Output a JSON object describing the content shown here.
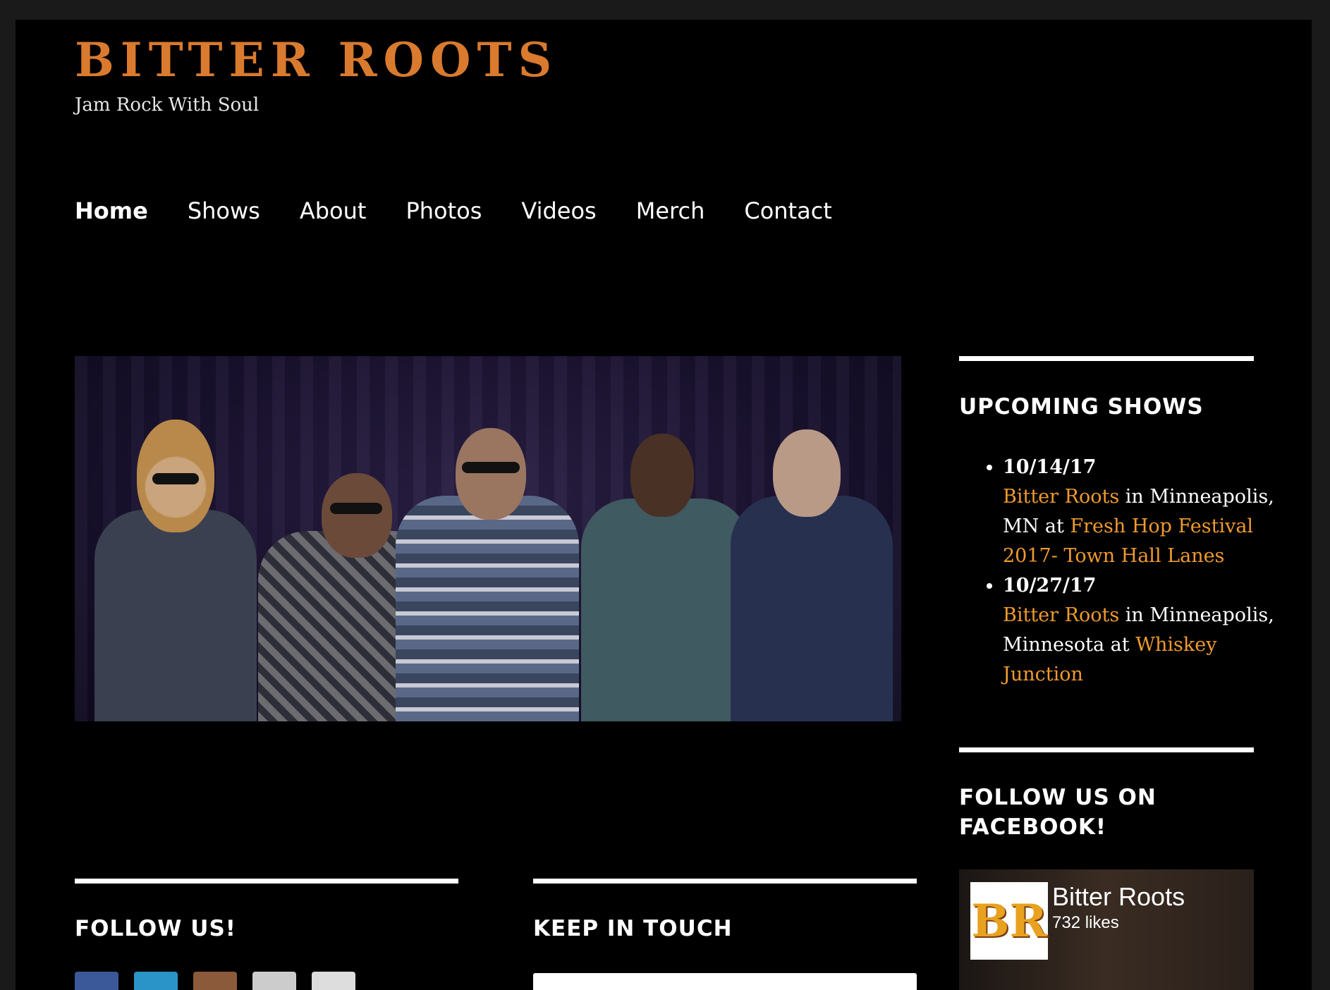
{
  "site": {
    "title": "BITTER ROOTS",
    "tagline": "Jam Rock With Soul"
  },
  "nav": {
    "items": [
      {
        "label": "Home",
        "active": true
      },
      {
        "label": "Shows"
      },
      {
        "label": "About"
      },
      {
        "label": "Photos"
      },
      {
        "label": "Videos"
      },
      {
        "label": "Merch"
      },
      {
        "label": "Contact"
      }
    ]
  },
  "sidebar": {
    "upcoming_title": "UPCOMING SHOWS",
    "shows": [
      {
        "date": "10/14/17",
        "artist": "Bitter Roots",
        "in_text": " in Minneapolis, MN at ",
        "venue": "Fresh Hop Festival 2017- Town Hall Lanes"
      },
      {
        "date": "10/27/17",
        "artist": "Bitter Roots",
        "in_text": " in Minneapolis, Minnesota at ",
        "venue": "Whiskey Junction"
      }
    ],
    "facebook_title": "FOLLOW US ON FACEBOOK!",
    "facebook": {
      "page_name": "Bitter Roots",
      "likes": "732 likes",
      "logo_text": "BR"
    }
  },
  "footer_widgets": {
    "follow_title": "FOLLOW US!",
    "keep_title": "KEEP IN TOUCH"
  },
  "social_icons": [
    "facebook-icon",
    "twitter-icon",
    "instagram-icon",
    "reverbnation-icon",
    "youtube-icon"
  ],
  "colors": {
    "accent": "#ef9a2e",
    "title": "#d97a2e",
    "background": "#000000"
  }
}
